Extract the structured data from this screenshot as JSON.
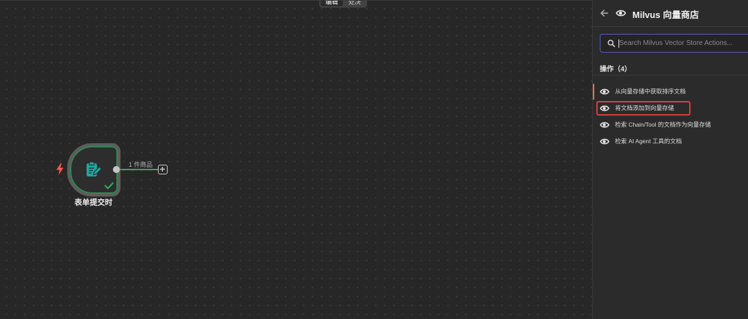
{
  "canvas": {
    "mode_tabs": [
      {
        "label": "编辑",
        "active": true
      },
      {
        "label": "处决",
        "active": false
      }
    ],
    "node": {
      "label": "表单提交时",
      "icon": "form-icon",
      "trigger_icon": "lightning-icon",
      "status_icon": "check-icon",
      "status": "success"
    },
    "connection": {
      "label": "1 件商品"
    },
    "add_node_icon": "plus-icon"
  },
  "panel": {
    "back_icon": "arrow-left-icon",
    "title_icon": "milvus-logo-icon",
    "title": "Milvus 向量商店",
    "search": {
      "icon": "search-icon",
      "placeholder": "Search Milvus Vector Store Actions...",
      "value": ""
    },
    "section_title": "操作（4）",
    "actions": [
      {
        "label": "从向量存储中获取排序文档",
        "icon": "milvus-logo-icon",
        "active": true,
        "highlighted": false
      },
      {
        "label": "将文档添加到向量存储",
        "icon": "milvus-logo-icon",
        "active": false,
        "highlighted": true
      },
      {
        "label": "检索 Chain/Tool 的文档作为向量存储",
        "icon": "milvus-logo-icon",
        "active": false,
        "highlighted": false
      },
      {
        "label": "检索 AI Agent 工具的文档",
        "icon": "milvus-logo-icon",
        "active": false,
        "highlighted": false
      }
    ]
  },
  "colors": {
    "accent": "#ff6d5a",
    "highlight": "#e03b3b",
    "success": "#3aa55d",
    "focus": "#5b5bc6",
    "node_icon": "#1fa6a0"
  }
}
